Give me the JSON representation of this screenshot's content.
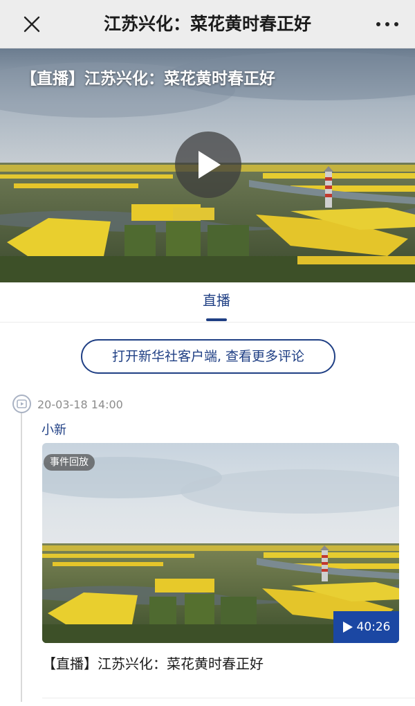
{
  "header": {
    "title": "江苏兴化：菜花黄时春正好"
  },
  "hero": {
    "title": "【直播】江苏兴化：菜花黄时春正好"
  },
  "tabs": [
    {
      "label": "直播",
      "active": true
    }
  ],
  "open_app_label": "打开新华社客户端, 查看更多评论",
  "post": {
    "time": "20-03-18 14:00",
    "author": "小新",
    "video": {
      "badge": "事件回放",
      "duration": "40:26",
      "title": "【直播】江苏兴化：菜花黄时春正好"
    }
  },
  "colors": {
    "accent": "#1f3f84",
    "duration_bg": "#1b47a3",
    "canola_yellow": "#e6c52a"
  },
  "icons": {
    "close": "close-icon",
    "more": "more-dots-icon",
    "play": "play-icon",
    "timeline": "video-dot-icon"
  }
}
